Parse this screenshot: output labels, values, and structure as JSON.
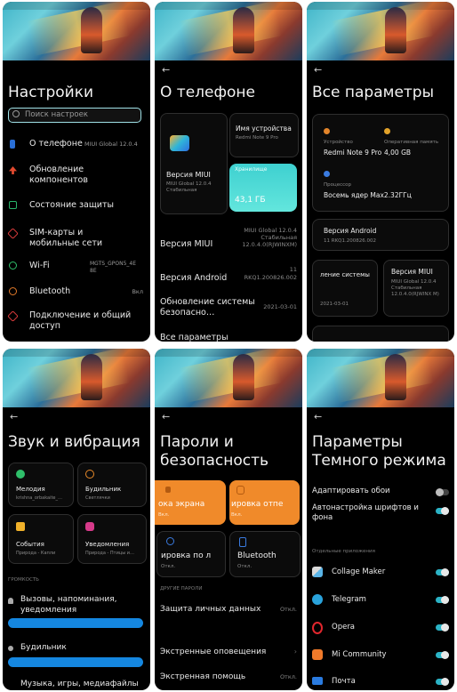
{
  "p1": {
    "title": "Настройки",
    "search_placeholder": "Поиск настроек",
    "items": [
      {
        "label": "О телефоне",
        "value": "MIUI Global 12.0.4"
      },
      {
        "label": "Обновление компонентов",
        "value": ""
      },
      {
        "label": "Состояние защиты",
        "value": ""
      },
      {
        "label": "SIM-карты и мобильные сети",
        "value": ""
      },
      {
        "label": "Wi-Fi",
        "value": "MGTS_GPON5_4E 8E"
      },
      {
        "label": "Bluetooth",
        "value": "Вкл"
      },
      {
        "label": "Подключение и общий доступ",
        "value": ""
      }
    ]
  },
  "p2": {
    "title": "О телефоне",
    "miui_card_title": "Версия MIUI",
    "miui_card_sub": "MIUI Global 12.0.4 Стабильная",
    "device_name_label": "Имя устройства",
    "device_name_value": "Redmi Note 9 Pro",
    "storage_label": "Хранилище",
    "storage_value": "43,1 ГБ",
    "rows": [
      {
        "label": "Версия MIUI",
        "value": "MIUI Global 12.0.4 Стабильная 12.0.4.0(RJWINXM)"
      },
      {
        "label": "Версия Android",
        "value": "11 RKQ1.200826.002"
      },
      {
        "label": "Обновление системы безопасно…",
        "value": "2021-03-01"
      },
      {
        "label": "Все параметры",
        "value": ""
      }
    ]
  },
  "p3": {
    "title": "Все параметры",
    "device_label": "Устройство",
    "device_value": "Redmi Note 9 Pro",
    "ram_label": "Оперативная память",
    "ram_value": "4,00 GB",
    "cpu_label": "Процессор",
    "cpu_value": "Восемь ядер Max2.32ГГц",
    "android_label": "Версия Android",
    "android_value": "11 RKQ1.200826.002",
    "security_label": "ление системы",
    "security_value": "2021-03-01",
    "miui_label": "Версия MIUI",
    "miui_value": "MIUI Global 12.0.4 Стабильная 12.0.4.0(RJWINX M)"
  },
  "p4": {
    "title": "Звук и вибрация",
    "cards": [
      {
        "label": "Мелодия",
        "sub": "krishna_orbakaite_…"
      },
      {
        "label": "Будильник",
        "sub": "Светлячки"
      },
      {
        "label": "События",
        "sub": "Природа - Капли"
      },
      {
        "label": "Уведомления",
        "sub": "Природа - Птицы и…"
      }
    ],
    "volume_header": "ГРОМКОСТЬ",
    "vol_calls": "Вызовы, напоминания, уведомления",
    "vol_alarm": "Будильник",
    "vol_media": "Музыка, игры, медиафайлы"
  },
  "p5": {
    "title": "Пароли и безопасность",
    "lock_card": "ока экрана",
    "lock_card_status": "Вкл.",
    "fp_card": "ировка отпе",
    "fp_card_status": "Вкл.",
    "face_card": "ировка по л",
    "face_card_status": "Откл.",
    "bt_card": "Bluetooth",
    "bt_card_status": "Откл.",
    "other_header": "ДРУГИЕ ПАРОЛИ",
    "privacy": "Защита личных данных",
    "privacy_value": "Откл.",
    "alerts": "Экстренные оповещения",
    "sos": "Экстренная помощь",
    "sos_value": "Откл."
  },
  "p6": {
    "title": "Параметры Темного режима",
    "adapt_wallpaper": "Адаптировать обои",
    "auto_fonts": "Автонастройка шрифтов и фона",
    "apps_header": "Отдельные приложения",
    "apps": [
      "Collage Maker",
      "Telegram",
      "Opera",
      "Mi Community",
      "Почта"
    ]
  }
}
